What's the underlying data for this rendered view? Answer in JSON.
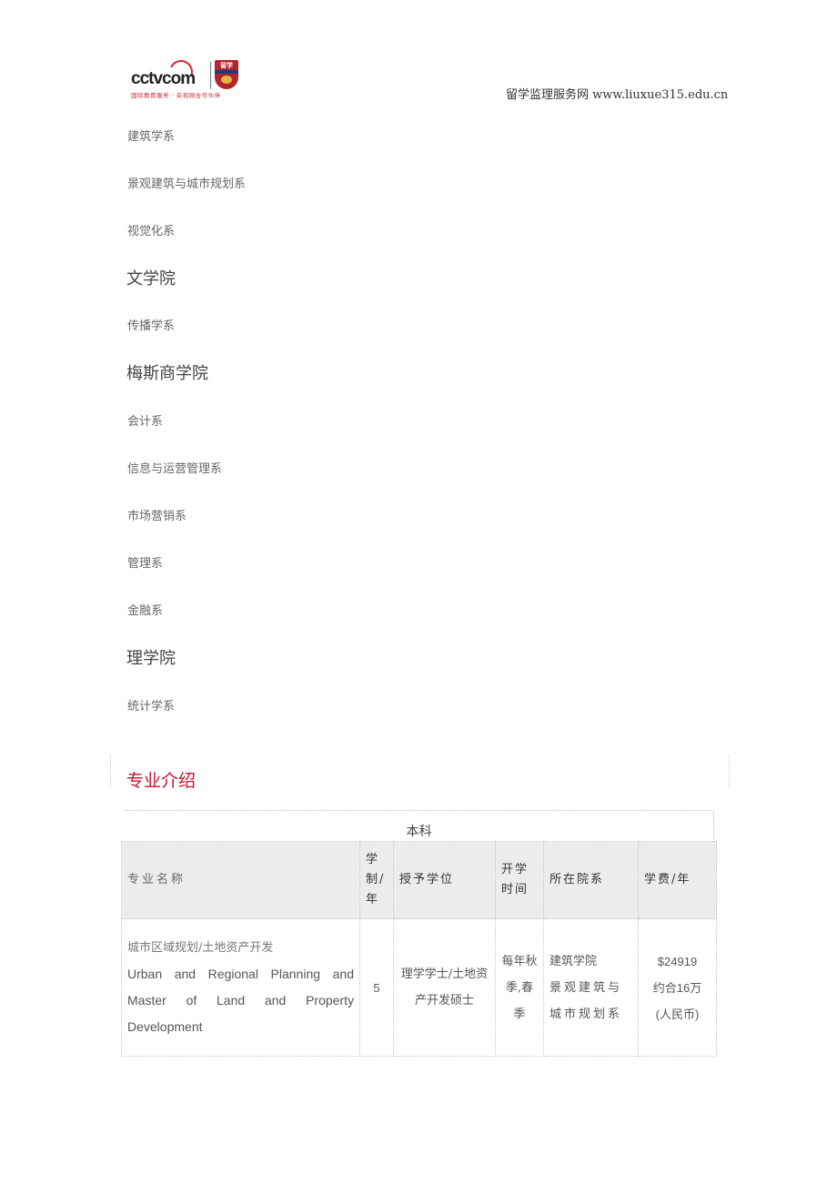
{
  "header": {
    "logo": {
      "brand": "cctvcom",
      "tagline": "国际教育服务 · 央视网合作伙伴",
      "badge": "留学",
      "accent_color": "#d0262e"
    },
    "site_label": "留学监理服务网 www.liuxue315.edu.cn"
  },
  "departments": [
    {
      "type": "item",
      "label": "建筑学系"
    },
    {
      "type": "item",
      "label": "景观建筑与城市规划系"
    },
    {
      "type": "item",
      "label": "视觉化系"
    },
    {
      "type": "college",
      "label": "文学院"
    },
    {
      "type": "item",
      "label": "传播学系"
    },
    {
      "type": "college",
      "label": "梅斯商学院"
    },
    {
      "type": "item",
      "label": "会计系"
    },
    {
      "type": "item",
      "label": "信息与运营管理系"
    },
    {
      "type": "item",
      "label": "市场营销系"
    },
    {
      "type": "item",
      "label": "管理系"
    },
    {
      "type": "item",
      "label": "金融系"
    },
    {
      "type": "college",
      "label": "理学院"
    },
    {
      "type": "item",
      "label": "统计学系"
    }
  ],
  "section": {
    "title": "专业介绍",
    "title_color": "#c8102e"
  },
  "program_table": {
    "caption": "本科",
    "headers": [
      "专业名称",
      "学制/年",
      "授予学位",
      "开学时间",
      "所在院系",
      "学费/年"
    ],
    "rows": [
      {
        "name_cn": "城市区域规划/土地资产开发",
        "name_en": "Urban and Regional Planning and Master of Land and Property Development",
        "duration": "5",
        "degree": "理学学士/土地资产开发硕士",
        "intake": "每年秋季,春季",
        "college": "建筑学院",
        "department": "景观建筑与城市规划系",
        "fee_usd": "$24919",
        "fee_cny": "约合16万",
        "fee_cny_unit": "(人民币)"
      }
    ]
  }
}
